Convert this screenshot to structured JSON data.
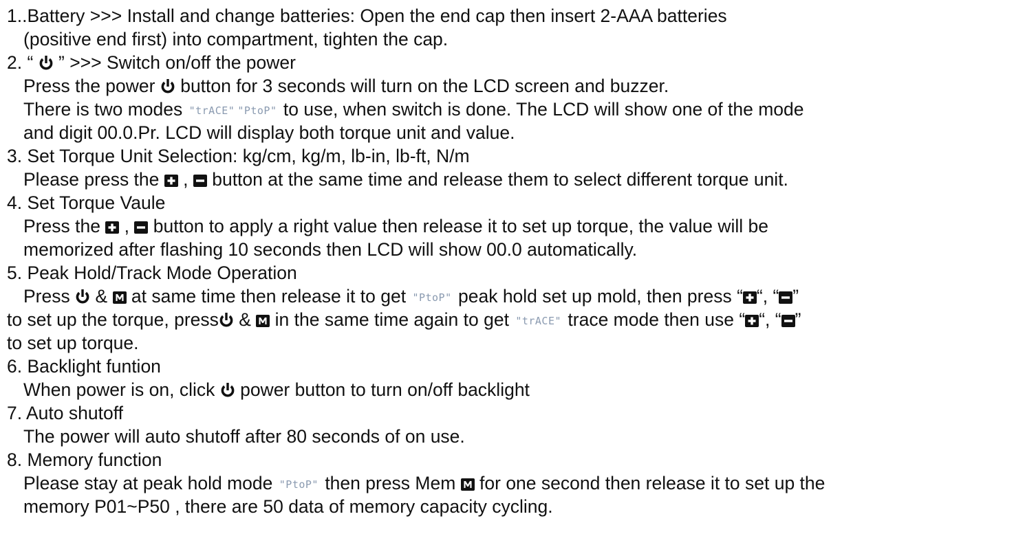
{
  "doc": {
    "l1": {
      "a": "1..Battery >>> Install and change batteries: Open the end cap then insert 2-AAA batteries"
    },
    "l2": {
      "a": "(positive end first) into compartment, tighten the cap."
    },
    "l3": {
      "a": "2. “ ",
      "b": " ” >>> Switch on/off the power"
    },
    "l4": {
      "a": "Press the power ",
      "b": " button for 3 seconds will turn on the LCD screen and buzzer."
    },
    "l5": {
      "a": "There is two modes ",
      "b": " to use, when switch is done. The LCD will show one of the mode"
    },
    "l6": {
      "a": "and digit 00.0.Pr. LCD will display both torque unit and value."
    },
    "l7": {
      "a": "3. Set Torque Unit Selection: kg/cm, kg/m, lb-in, lb-ft, N/m"
    },
    "l8": {
      "a": "Please press the ",
      "b": " , ",
      "c": " button at the same time and release them to select different torque unit."
    },
    "l9": {
      "a": "4. Set Torque Vaule"
    },
    "l10": {
      "a": "Press the ",
      "b": " , ",
      "c": " button to apply a right value then release it to set up torque, the value will be"
    },
    "l11": {
      "a": "memorized after flashing 10 seconds then LCD will show 00.0 automatically."
    },
    "l12": {
      "a": "5. Peak Hold/Track Mode Operation"
    },
    "l13": {
      "a": "Press ",
      "b": " & ",
      "c": " at same time then release it to get ",
      "d": " peak hold set up mold, then press “",
      "e": "“, “",
      "f": "”"
    },
    "l14": {
      "a": "to set up the torque, press",
      "b": " & ",
      "c": " in the same time again to get ",
      "d": " trace mode then use “",
      "e": "“, “",
      "f": "”"
    },
    "l15": {
      "a": "to set up torque."
    },
    "l16": {
      "a": "6. Backlight funtion"
    },
    "l17": {
      "a": "When power is on, click ",
      "b": " power button to turn on/off backlight"
    },
    "l18": {
      "a": "7. Auto shutoff"
    },
    "l19": {
      "a": "The power will auto shutoff after 80 seconds of on use."
    },
    "l20": {
      "a": "8. Memory function"
    },
    "l21": {
      "a": "Please stay at peak hold mode ",
      "b": " then press Mem ",
      "c": " for one second then release it to set up the"
    },
    "l22": {
      "a": "memory P01~P50 , there are 50 data of memory capacity cycling."
    }
  },
  "lcd": {
    "trace": "\"trACE\"",
    "ptop": "\"PtoP\""
  },
  "icons": {
    "power": "power-icon",
    "plus": "plus-button-icon",
    "minus": "minus-button-icon",
    "mem": "mem-button-icon"
  },
  "colors": {
    "text": "#111111",
    "lcd_text": "#8a9ab0",
    "icon": "#111111"
  }
}
